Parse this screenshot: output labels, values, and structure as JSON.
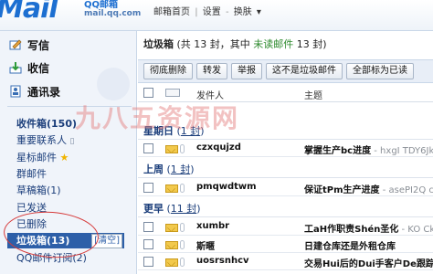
{
  "header": {
    "logo_mark": "Mail",
    "logo_text": "QQ邮箱",
    "logo_domain": "mail.qq.com",
    "nav": [
      "邮箱首页",
      "设置",
      "换肤"
    ]
  },
  "sidebar": {
    "write": "写信",
    "receive": "收信",
    "contacts": "通讯录",
    "folders": {
      "inbox": "收件箱(150)",
      "important": "重要联系人",
      "starred": "星标邮件",
      "group": "群邮件",
      "draft": "草稿箱(1)",
      "sent": "已发送",
      "deleted": "已删除",
      "spam": "垃圾箱(13)",
      "spam_clear": "[清空]",
      "qq_sub": "QQ邮件订阅(2)"
    }
  },
  "main": {
    "title": "垃圾箱",
    "title_pre": " (共 13 封，其中 ",
    "title_unread": "未读邮件",
    "title_post": " 13 封)",
    "toolbar": [
      "彻底删除",
      "转发",
      "举报",
      "这不是垃圾邮件",
      "全部标为已读"
    ],
    "columns": {
      "sender": "发件人",
      "subject": "主题"
    },
    "groups": {
      "wed": {
        "label": "星期日",
        "count_pre": " (",
        "count": "1 封",
        "count_post": ")"
      },
      "last": {
        "label": "上周",
        "count_pre": " (",
        "count": "1 封",
        "count_post": ")"
      },
      "earlier": {
        "label": "更早",
        "count_pre": " (",
        "count": "11 封",
        "count_post": ")"
      }
    },
    "rows": [
      {
        "sender": "czxqujzd",
        "subject": "掌握生产bc进度",
        "preview": " - hxgI TDY6Jk"
      },
      {
        "sender": "pmqwdtwm",
        "subject": "保证tPm生产进度",
        "preview": " - asePI2Q c"
      },
      {
        "sender": "xumbr",
        "subject": "工aH作职责Shén圣化",
        "preview": " - KO Ck"
      },
      {
        "sender": "斯暱",
        "subject": "日建仓库还是外租仓库",
        "preview": ""
      },
      {
        "sender": "uosrsnhcv",
        "subject": "交易Hui后的Dui手客户De跟踪",
        "preview": ""
      }
    ]
  },
  "watermark": "九八五资源网",
  "colors": {
    "accent": "#2d5fa8",
    "brand": "#1d6fd1",
    "annotation": "#d63a3a"
  }
}
